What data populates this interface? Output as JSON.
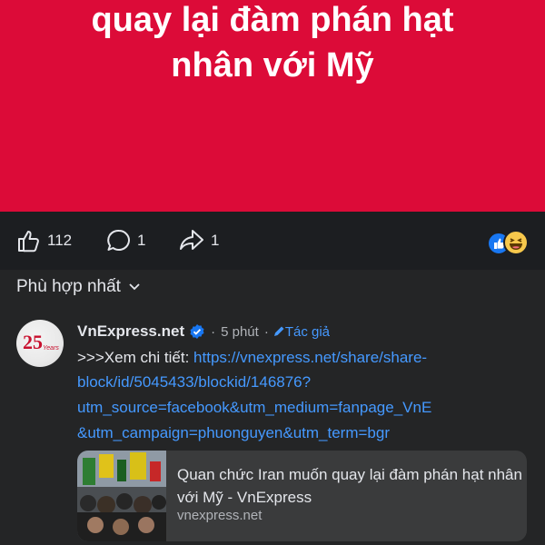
{
  "hero": {
    "line1": "quay lại đàm phán hạt",
    "line2": "nhân với Mỹ"
  },
  "actions": {
    "likes": "112",
    "comments": "1",
    "shares": "1"
  },
  "sort": {
    "label": "Phù hợp nhất"
  },
  "comment": {
    "avatar_text": "25",
    "avatar_sub": "Years",
    "author": "VnExpress.net",
    "separator1": "·",
    "time": "5 phút",
    "separator2": "·",
    "author_tag": "Tác giả",
    "text_prefix": ">>>Xem chi tiết: ",
    "link_line1": "https://vnexpress.net/share/share-",
    "link_line2": "block/id/5045433/blockid/146876?",
    "link_line3": "utm_source=facebook&utm_medium=fanpage_VnE",
    "link_line4": "&utm_campaign=phuonguyen&utm_term=bgr"
  },
  "link_card": {
    "title": "Quan chức Iran muốn quay lại đàm phán hạt nhân với Mỹ - VnExpress",
    "domain": "vnexpress.net"
  },
  "colors": {
    "hero_bg": "#dc0b38",
    "dark_bg": "#242526",
    "link": "#4599ff",
    "verified": "#1877f2"
  }
}
